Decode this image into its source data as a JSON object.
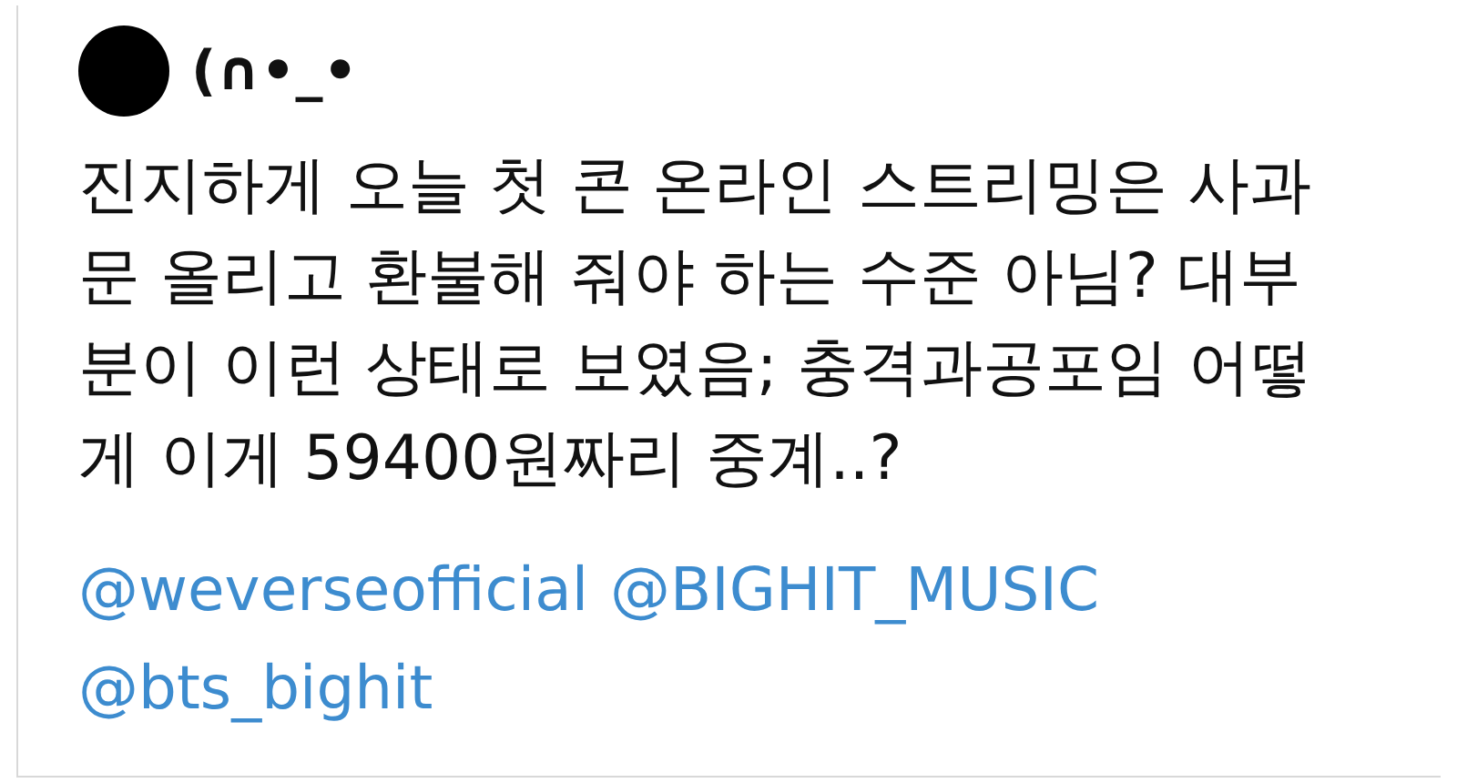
{
  "author": {
    "name": "(∩•_•"
  },
  "body_lines": [
    "진지하게 오늘 첫 콘 온라인 스트리밍은 사과",
    "문 올리고 환불해 줘야 하는 수준 아님? 대부",
    "분이 이런 상태로 보였음; 충격과공포임 어떻",
    "게 이게 59400원짜리 중계..?"
  ],
  "mention_lines": [
    [
      "@weverseofficial",
      "@BIGHIT_MUSIC"
    ],
    [
      "@bts_bighit"
    ]
  ]
}
